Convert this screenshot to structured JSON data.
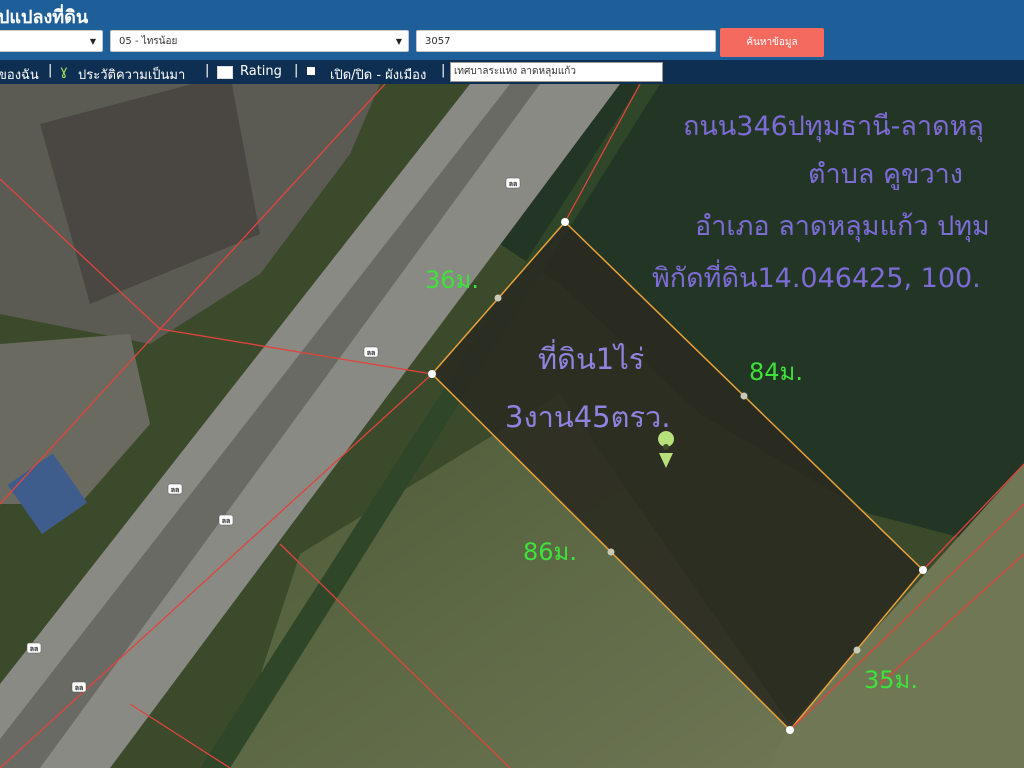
{
  "header": {
    "title": "ปแปลงที่ดิน",
    "province_select": "",
    "district_select": "05 - ไทรน้อย",
    "parcel_input": "3057",
    "search_button": "ค้นหาข้อมูล"
  },
  "toolbar": {
    "item1": "ของฉัน",
    "item2": "ประวัติความเป็นมา",
    "item3": "Rating",
    "item4": "เปิด/ปิด - ผังเมือง",
    "search_value": "เทศบาลระแหง ลาดหลุมแก้ว"
  },
  "map": {
    "info_lines": [
      "ถนน346ปทุมธานี-ลาดหลุ",
      "ตำบล คูขวาง",
      "อำเภอ ลาดหลุมแก้ว ปทุม",
      "พิกัดที่ดิน14.046425, 100."
    ],
    "area_lines": [
      "ที่ดิน1ไร่",
      "3งาน45ตรว."
    ],
    "dimensions": {
      "top": "36ม.",
      "right": "84ม.",
      "left": "86ม.",
      "bottom": "35ม."
    },
    "road_marker": "ลล"
  },
  "colors": {
    "header": "#1f5f99",
    "toolbar": "#0e2f52",
    "search_button": "#f46a5e",
    "parcel_lines": "#e0443c",
    "plot_border": "#e8a13a",
    "dimension_text": "#3ee23a",
    "annotation_text": "#7d6bd6"
  }
}
